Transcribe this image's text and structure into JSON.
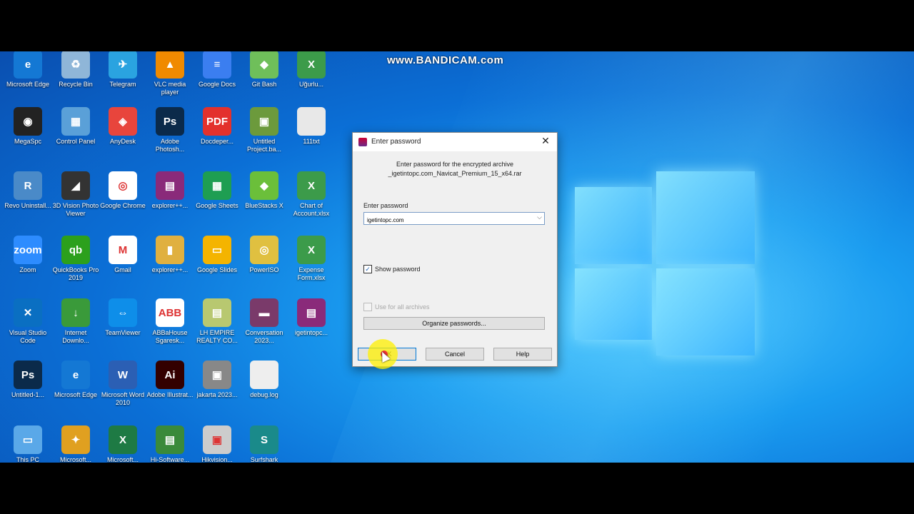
{
  "watermark": "www.BANDICAM.com",
  "desktop": {
    "icons": [
      {
        "label": "Microsoft Edge",
        "color": "#1478d4",
        "glyph": "e",
        "icon": "edge-icon"
      },
      {
        "label": "Recycle Bin",
        "color": "#8fb6d8",
        "glyph": "♻",
        "icon": "recycle-bin-icon"
      },
      {
        "label": "Telegram",
        "color": "#2aa3e0",
        "glyph": "✈",
        "icon": "telegram-icon"
      },
      {
        "label": "VLC media player",
        "color": "#f08a00",
        "glyph": "▲",
        "icon": "vlc-icon"
      },
      {
        "label": "Google Docs",
        "color": "#3b7ef0",
        "glyph": "≡",
        "icon": "google-docs-icon"
      },
      {
        "label": "Git Bash",
        "color": "#6fbf5a",
        "glyph": "◆",
        "icon": "git-bash-icon"
      },
      {
        "label": "Uğurlu...",
        "color": "#3c9b4a",
        "glyph": "X",
        "icon": "excel-file-icon"
      },
      {
        "label": "MegaSpc",
        "color": "#222",
        "glyph": "◉",
        "icon": "megaspc-icon"
      },
      {
        "label": "Control Panel",
        "color": "#5aa0d8",
        "glyph": "▦",
        "icon": "control-panel-icon"
      },
      {
        "label": "AnyDesk",
        "color": "#e8453c",
        "glyph": "◈",
        "icon": "anydesk-icon"
      },
      {
        "label": "Adobe Photosh...",
        "color": "#0b2a4a",
        "glyph": "Ps",
        "icon": "photoshop-icon"
      },
      {
        "label": "Docdeper...",
        "color": "#e3312d",
        "glyph": "PDF",
        "icon": "pdf-icon"
      },
      {
        "label": "Untitled Project.ba...",
        "color": "#6c9a3c",
        "glyph": "▣",
        "icon": "project-icon"
      },
      {
        "label": "111txt",
        "color": "#e8e8e8",
        "glyph": "",
        "icon": "text-file-icon"
      },
      {
        "label": "Revo Uninstall...",
        "color": "#4a8ac8",
        "glyph": "R",
        "icon": "revo-uninstaller-icon"
      },
      {
        "label": "3D Vision Photo Viewer",
        "color": "#333",
        "glyph": "◢",
        "icon": "3d-vision-icon"
      },
      {
        "label": "Google Chrome",
        "color": "#fff",
        "glyph": "◎",
        "icon": "chrome-icon"
      },
      {
        "label": "explorer++...",
        "color": "#8a2a7a",
        "glyph": "▤",
        "icon": "winrar-icon"
      },
      {
        "label": "Google Sheets",
        "color": "#1e9e52",
        "glyph": "▦",
        "icon": "google-sheets-icon"
      },
      {
        "label": "BlueStacks X",
        "color": "#6bbf3a",
        "glyph": "◆",
        "icon": "bluestacks-icon"
      },
      {
        "label": "Chart of Account.xlsx",
        "color": "#3c9b4a",
        "glyph": "X",
        "icon": "excel-file-icon"
      },
      {
        "label": "Zoom",
        "color": "#2d8cff",
        "glyph": "zoom",
        "icon": "zoom-icon"
      },
      {
        "label": "QuickBooks Pro 2019",
        "color": "#2ca01c",
        "glyph": "qb",
        "icon": "quickbooks-icon"
      },
      {
        "label": "Gmail",
        "color": "#fff",
        "glyph": "M",
        "icon": "gmail-icon"
      },
      {
        "label": "explorer++...",
        "color": "#e0b040",
        "glyph": "▮",
        "icon": "folder-icon"
      },
      {
        "label": "Google Slides",
        "color": "#f4b400",
        "glyph": "▭",
        "icon": "google-slides-icon"
      },
      {
        "label": "PowerISO",
        "color": "#e0c040",
        "glyph": "◎",
        "icon": "poweriso-icon"
      },
      {
        "label": "Expense Form.xlsx",
        "color": "#3c9b4a",
        "glyph": "X",
        "icon": "excel-file-icon"
      },
      {
        "label": "Visual Studio Code",
        "color": "#0a6fc2",
        "glyph": "✕",
        "icon": "vscode-icon"
      },
      {
        "label": "Internet Downlo...",
        "color": "#3a9a3a",
        "glyph": "↓",
        "icon": "idm-icon"
      },
      {
        "label": "TeamViewer",
        "color": "#0e8ee9",
        "glyph": "⇔",
        "icon": "teamviewer-icon"
      },
      {
        "label": "ABBaHouse Sgaresk...",
        "color": "#fff",
        "glyph": "ABB",
        "icon": "app-icon"
      },
      {
        "label": "LH EMPIRE REALTY CO...",
        "color": "#b8c870",
        "glyph": "▤",
        "icon": "spreadsheet-icon"
      },
      {
        "label": "Conversation 2023...",
        "color": "#7a3a6a",
        "glyph": "▬",
        "icon": "video-file-icon"
      },
      {
        "label": "igetintopc...",
        "color": "#8a2a7a",
        "glyph": "▤",
        "icon": "winrar-icon"
      },
      {
        "label": "Untitled-1...",
        "color": "#0b2a4a",
        "glyph": "Ps",
        "icon": "photoshop-file-icon"
      },
      {
        "label": "Microsoft Edge",
        "color": "#1478d4",
        "glyph": "e",
        "icon": "edge-icon"
      },
      {
        "label": "Microsoft Word 2010",
        "color": "#2b5fb4",
        "glyph": "W",
        "icon": "word-icon"
      },
      {
        "label": "Adobe Illustrat...",
        "color": "#330000",
        "glyph": "Ai",
        "icon": "illustrator-icon"
      },
      {
        "label": "jakarta 2023...",
        "color": "#888",
        "glyph": "▣",
        "icon": "image-file-icon"
      },
      {
        "label": "debug.log",
        "color": "#eee",
        "glyph": "",
        "icon": "text-file-icon"
      },
      {
        "label": "",
        "color": "transparent",
        "glyph": "",
        "icon": "blank-icon"
      },
      {
        "label": "This PC",
        "color": "#5aa8e8",
        "glyph": "▭",
        "icon": "this-pc-icon"
      },
      {
        "label": "Microsoft...",
        "color": "#e0a020",
        "glyph": "✦",
        "icon": "app-icon"
      },
      {
        "label": "Microsoft...",
        "color": "#1e7a44",
        "glyph": "X",
        "icon": "excel-icon"
      },
      {
        "label": "Hi-Software...",
        "color": "#3a8a3a",
        "glyph": "▤",
        "icon": "app-icon"
      },
      {
        "label": "Hikvision...",
        "color": "#ccc",
        "glyph": "▣",
        "icon": "app-icon"
      },
      {
        "label": "Surfshark",
        "color": "#1a8a8a",
        "glyph": "S",
        "icon": "surfshark-icon"
      }
    ]
  },
  "dialog": {
    "title": "Enter password",
    "close": "✕",
    "prompt_line1": "Enter password for the encrypted archive",
    "prompt_line2": "_igetintopc.com_Navicat_Premium_15_x64.rar",
    "password_label": "Enter password",
    "password_value": "igetintopc.com",
    "dropdown": "⌵",
    "show_password": "Show password",
    "show_password_check": "✓",
    "use_all": "Use for all archives",
    "organize": "Organize passwords...",
    "ok": "OK",
    "cancel": "Cancel",
    "help": "Help"
  }
}
